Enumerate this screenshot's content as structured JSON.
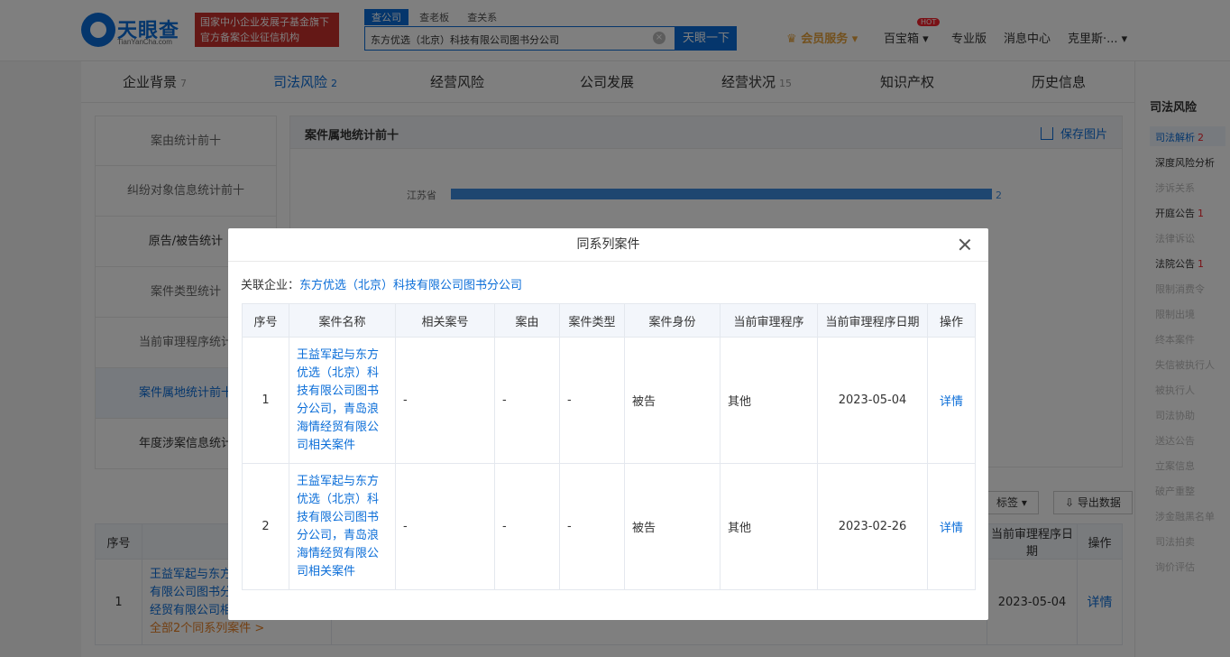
{
  "header": {
    "logo_text": "天眼查",
    "logo_sub": "TianYanCha.com",
    "banner_line1": "国家中小企业发展子基金旗下",
    "banner_line2": "官方备案企业征信机构",
    "search_tabs": [
      "查公司",
      "查老板",
      "查关系"
    ],
    "search_value": "东方优选（北京）科技有限公司图书分公司",
    "search_button": "天眼一下",
    "vip": "会员服务",
    "baibaoxiang": "百宝箱",
    "hot": "HOT",
    "pro": "专业版",
    "messages": "消息中心",
    "user": "克里斯·..."
  },
  "tabs": [
    {
      "label": "企业背景",
      "count": "7"
    },
    {
      "label": "司法风险",
      "count": "2"
    },
    {
      "label": "经营风险",
      "count": ""
    },
    {
      "label": "公司发展",
      "count": ""
    },
    {
      "label": "经营状况",
      "count": "15"
    },
    {
      "label": "知识产权",
      "count": ""
    },
    {
      "label": "历史信息",
      "count": ""
    }
  ],
  "left_menu": [
    "案由统计前十",
    "纠纷对象信息统计前十",
    "原告/被告统计",
    "案件类型统计",
    "当前审理程序统计",
    "案件属地统计前十",
    "年度涉案信息统计"
  ],
  "chart": {
    "title": "案件属地统计前十",
    "save": "保存图片",
    "chart_data": {
      "type": "bar",
      "categories": [
        "江苏省"
      ],
      "values": [
        2
      ]
    }
  },
  "bg": {
    "export": "导出数据",
    "tag": "标签",
    "col_no": "序号",
    "col_name": "案",
    "col_date": "当前审理程序日期",
    "col_op": "操作",
    "row_no": "1",
    "row_name_1": "王益军起与东方",
    "row_name_2": "有限公司图书分",
    "row_name_3": "经贸有限公司相",
    "row_more": "全部2个同系列案件 >",
    "row_date": "2023-05-04",
    "row_op": "详情"
  },
  "rightbar": {
    "title": "司法风险",
    "items": [
      {
        "label": "司法解析",
        "n": "2"
      },
      {
        "label": "深度风险分析",
        "n": ""
      },
      {
        "label": "涉诉关系",
        "n": ""
      },
      {
        "label": "开庭公告",
        "n": "1"
      },
      {
        "label": "法律诉讼",
        "n": ""
      },
      {
        "label": "法院公告",
        "n": "1"
      },
      {
        "label": "限制消费令",
        "n": ""
      },
      {
        "label": "限制出境",
        "n": ""
      },
      {
        "label": "终本案件",
        "n": ""
      },
      {
        "label": "失信被执行人",
        "n": ""
      },
      {
        "label": "被执行人",
        "n": ""
      },
      {
        "label": "司法协助",
        "n": ""
      },
      {
        "label": "送达公告",
        "n": ""
      },
      {
        "label": "立案信息",
        "n": ""
      },
      {
        "label": "破产重整",
        "n": ""
      },
      {
        "label": "涉金融黑名单",
        "n": ""
      },
      {
        "label": "司法拍卖",
        "n": ""
      },
      {
        "label": "询价评估",
        "n": ""
      }
    ]
  },
  "modal": {
    "title": "同系列案件",
    "related_label": "关联企业：",
    "related_company": "东方优选（北京）科技有限公司图书分公司",
    "columns": [
      "序号",
      "案件名称",
      "相关案号",
      "案由",
      "案件类型",
      "案件身份",
      "当前审理程序",
      "当前审理程序日期",
      "操作"
    ],
    "rows": [
      {
        "no": "1",
        "name": "王益军起与东方优选（北京）科技有限公司图书分公司，青岛浪海情经贸有限公司相关案件",
        "case_no": "-",
        "cause": "-",
        "type": "-",
        "role": "被告",
        "stage": "其他",
        "date": "2023-05-04",
        "op": "详情"
      },
      {
        "no": "2",
        "name": "王益军起与东方优选（北京）科技有限公司图书分公司，青岛浪海情经贸有限公司相关案件",
        "case_no": "-",
        "cause": "-",
        "type": "-",
        "role": "被告",
        "stage": "其他",
        "date": "2023-02-26",
        "op": "详情"
      }
    ]
  }
}
